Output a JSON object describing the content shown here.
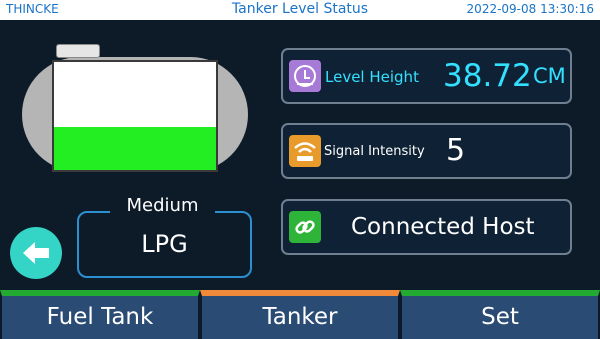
{
  "header": {
    "brand": "THINCKE",
    "title": "Tanker Level Status",
    "datetime": "2022-09-08 13:30:16"
  },
  "tank": {
    "fill_fraction": 0.4,
    "fill_color": "#22ee22"
  },
  "medium": {
    "label": "Medium",
    "value": "LPG"
  },
  "cards": {
    "level": {
      "label": "Level Height",
      "value": "38.72",
      "unit": "CM",
      "icon": "level-gauge-icon"
    },
    "signal": {
      "label": "Signal Intensity",
      "value": "5",
      "icon": "wifi-signal-icon"
    },
    "host": {
      "label": "Connected Host",
      "icon": "link-icon"
    }
  },
  "tabs": [
    {
      "label": "Fuel Tank",
      "color": "#22aa33"
    },
    {
      "label": "Tanker",
      "color": "#f08a3a"
    },
    {
      "label": "Set",
      "color": "#22aa33"
    }
  ],
  "colors": {
    "accent_cyan": "#33e0ff",
    "back_button": "#34d4c6",
    "panel_border": "#2b8fd0"
  }
}
